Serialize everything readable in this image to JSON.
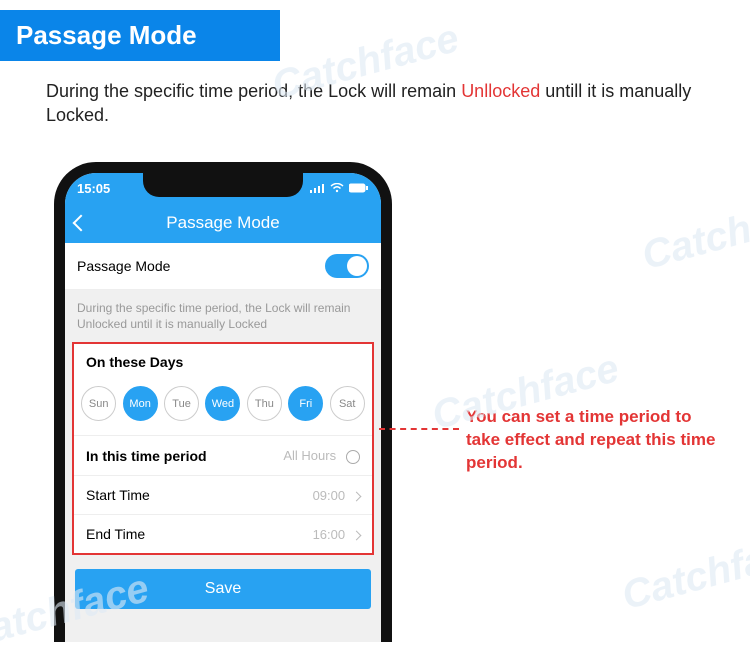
{
  "header": "Passage Mode",
  "description": {
    "pre": "During the specific time period, the Lock will remain ",
    "highlight": "Unllocked",
    "post": " untill it is manually Locked."
  },
  "statusbar": {
    "time": "15:05"
  },
  "titlebar": {
    "title": "Passage Mode"
  },
  "toggleRow": {
    "label": "Passage Mode",
    "on": true
  },
  "note": "During the specific time period, the Lock will remain Unlocked until it is manually Locked",
  "daysSection": {
    "title": "On these Days",
    "days": [
      {
        "label": "Sun",
        "on": false
      },
      {
        "label": "Mon",
        "on": true
      },
      {
        "label": "Tue",
        "on": false
      },
      {
        "label": "Wed",
        "on": true
      },
      {
        "label": "Thu",
        "on": false
      },
      {
        "label": "Fri",
        "on": true
      },
      {
        "label": "Sat",
        "on": false
      }
    ]
  },
  "period": {
    "label": "In this time period",
    "allHours": "All Hours",
    "start": {
      "label": "Start Time",
      "value": "09:00"
    },
    "end": {
      "label": "End Time",
      "value": "16:00"
    }
  },
  "save": "Save",
  "callout": "You can set a time period to take effect and repeat this time period.",
  "watermark": "Catchface"
}
